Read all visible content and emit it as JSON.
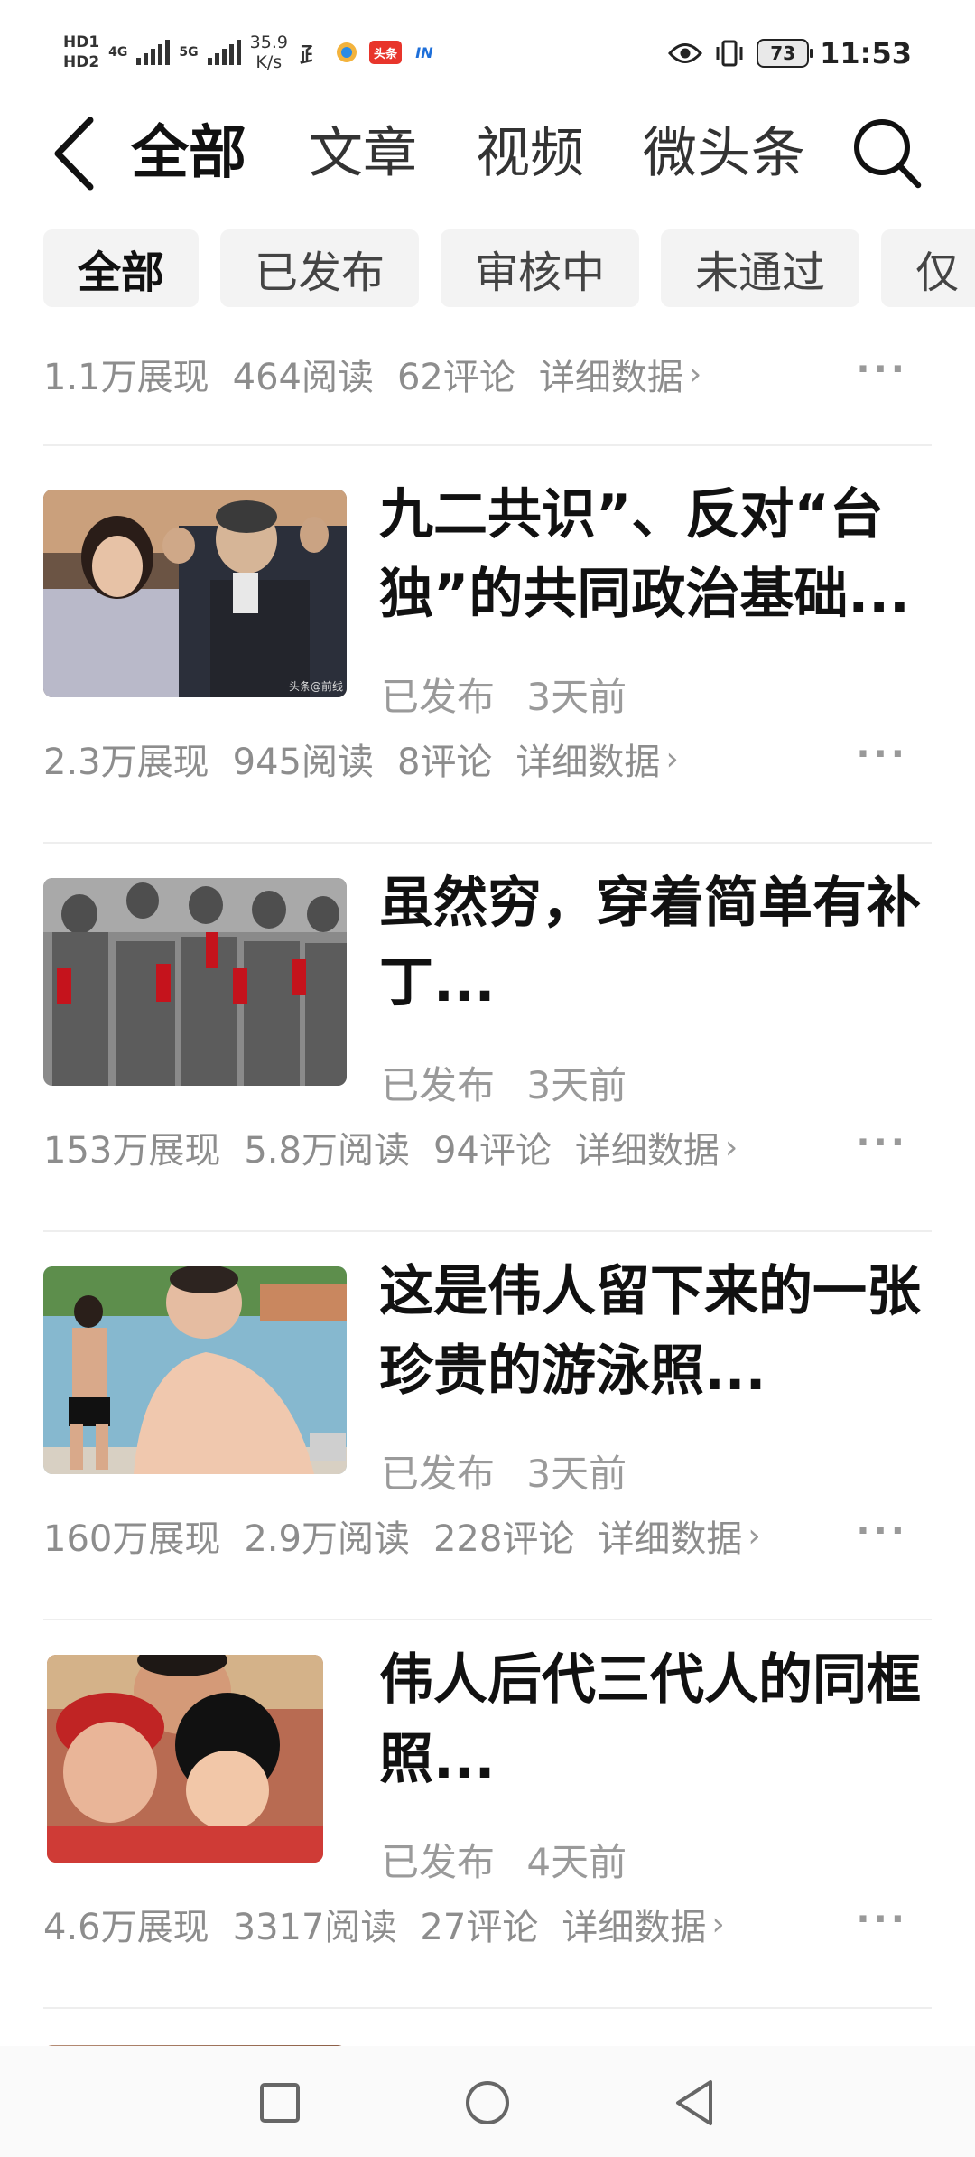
{
  "status_bar": {
    "hd1": "HD1",
    "hd2": "HD2",
    "net1": "4G",
    "net2": "5G",
    "speed_value": "35.9",
    "speed_unit": "K/s",
    "app_toutiao": "头条",
    "app_in": "IN",
    "battery": "73",
    "time": "11:53"
  },
  "nav": {
    "tabs": [
      {
        "label": "全部"
      },
      {
        "label": "文章"
      },
      {
        "label": "视频"
      },
      {
        "label": "微头条"
      }
    ]
  },
  "filters": [
    {
      "label": "全部"
    },
    {
      "label": "已发布"
    },
    {
      "label": "审核中"
    },
    {
      "label": "未通过"
    },
    {
      "label": "仅"
    }
  ],
  "partial_item": {
    "stats": {
      "impressions": "1.1万展现",
      "reads": "464阅读",
      "comments": "62评论",
      "detail": "详细数据"
    }
  },
  "items": [
    {
      "title": "九二共识”、反对“台独”的共同政治基础...",
      "status": "已发布",
      "time": "3天前",
      "stats": {
        "impressions": "2.3万展现",
        "reads": "945阅读",
        "comments": "8评论",
        "detail": "详细数据"
      },
      "thumb_caption": "头条@前线"
    },
    {
      "title": "虽然穷，穿着简单有补丁...",
      "status": "已发布",
      "time": "3天前",
      "stats": {
        "impressions": "153万展现",
        "reads": "5.8万阅读",
        "comments": "94评论",
        "detail": "详细数据"
      }
    },
    {
      "title": "这是伟人留下来的一张珍贵的游泳照...",
      "status": "已发布",
      "time": "3天前",
      "stats": {
        "impressions": "160万展现",
        "reads": "2.9万阅读",
        "comments": "228评论",
        "detail": "详细数据"
      }
    },
    {
      "title": "伟人后代三代人的同框照...",
      "status": "已发布",
      "time": "4天前",
      "stats": {
        "impressions": "4.6万展现",
        "reads": "3317阅读",
        "comments": "27评论",
        "detail": "详细数据"
      }
    }
  ],
  "more_glyph": "···",
  "chevron_glyph": "›",
  "colors": {
    "text_primary": "#111111",
    "text_secondary": "#8d8d8d",
    "chip_bg": "#f3f3f3",
    "divider": "#eeeeee"
  }
}
